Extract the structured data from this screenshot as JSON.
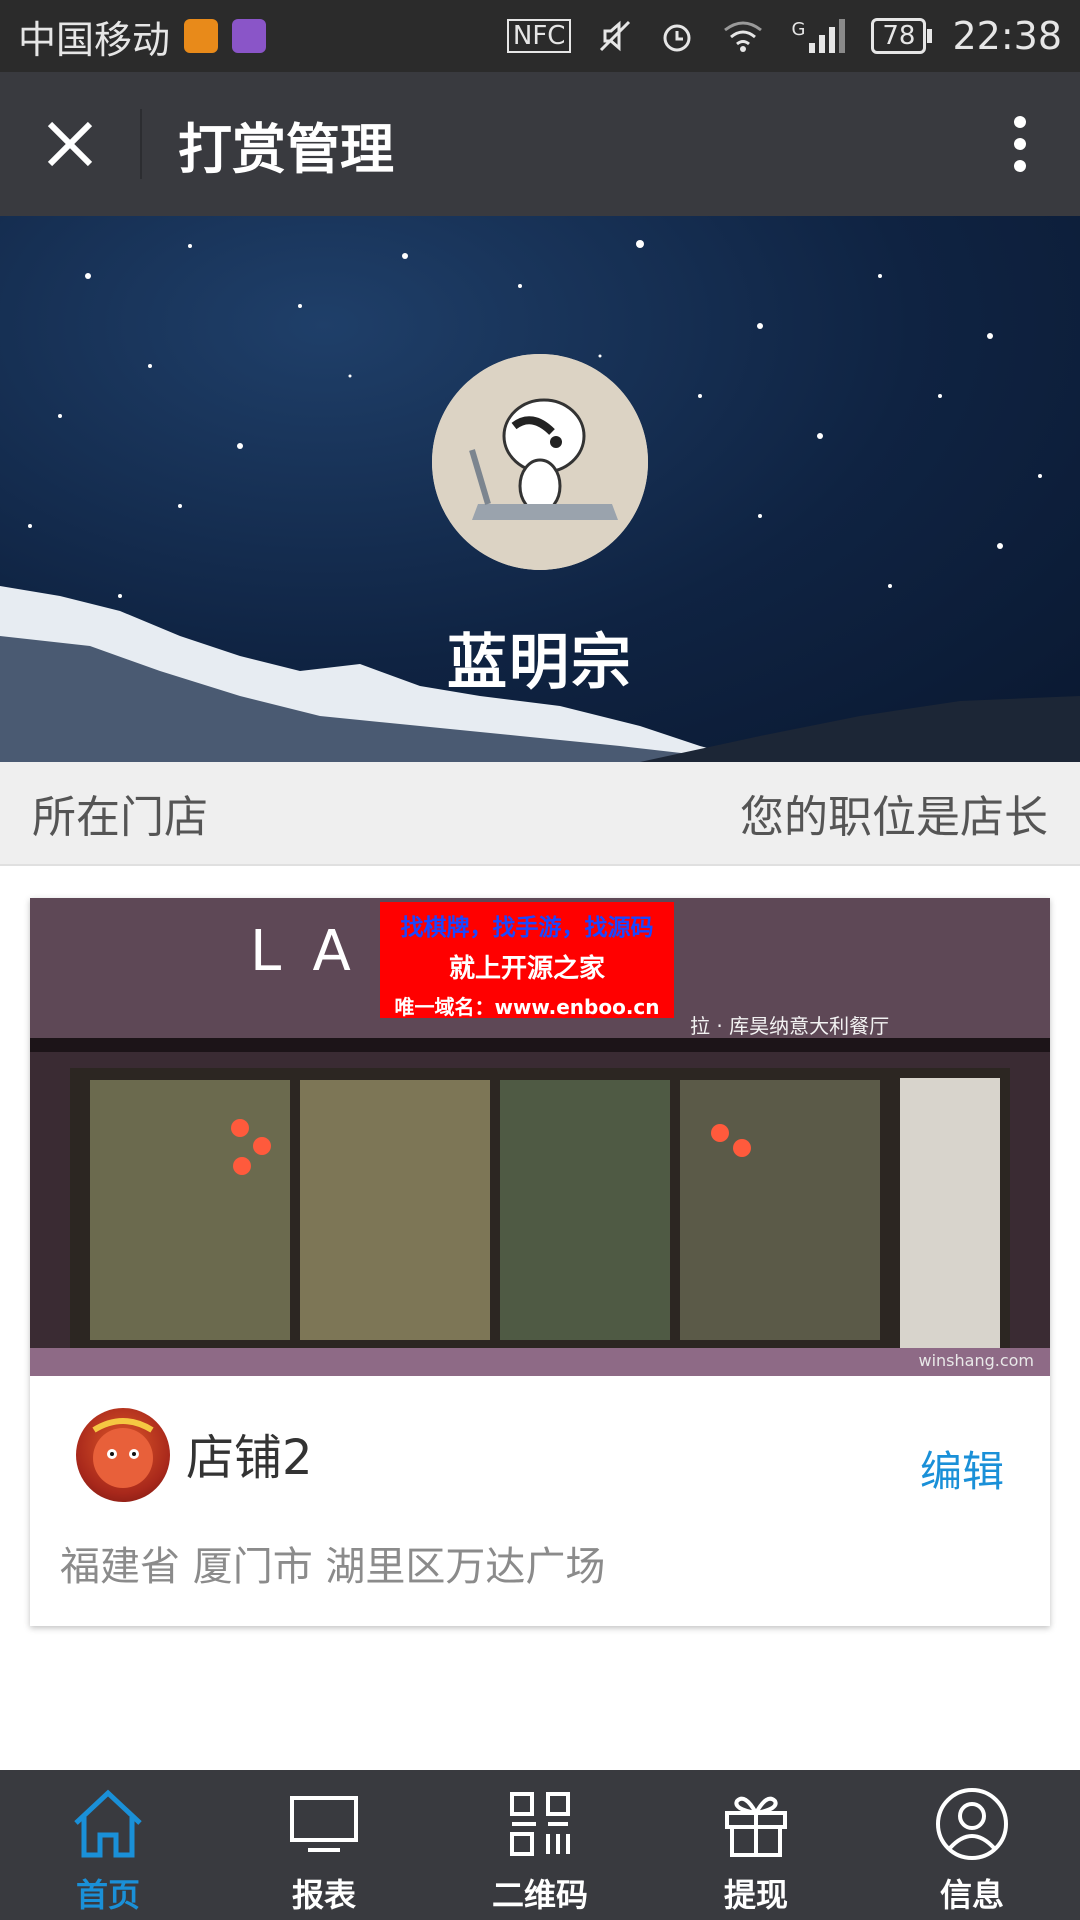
{
  "status_bar": {
    "carrier": "中国移动",
    "nfc": "NFC",
    "network": "G",
    "battery": "78",
    "time": "22:38"
  },
  "title_bar": {
    "title": "打赏管理",
    "close_icon": "close-icon",
    "more_icon": "more-vertical-icon"
  },
  "hero": {
    "name": "蓝明宗"
  },
  "store_header": {
    "left": "所在门店",
    "right": "您的职位是店长"
  },
  "store_card": {
    "name": "店铺2",
    "edit_label": "编辑",
    "address": "福建省 厦门市 湖里区万达广场",
    "image_sign": "LA",
    "image_sign_sub": "拉 · 库昊纳意大利餐厅",
    "image_credit": "winshang.com",
    "watermark": {
      "line1": "找棋牌，找手游，找源码",
      "line2": "就上开源之家",
      "line3": "唯一域名：www.enboo.cn"
    }
  },
  "bottom_nav": {
    "items": [
      {
        "label": "首页",
        "icon": "home-icon",
        "active": true
      },
      {
        "label": "报表",
        "icon": "monitor-icon",
        "active": false
      },
      {
        "label": "二维码",
        "icon": "qrcode-icon",
        "active": false
      },
      {
        "label": "提现",
        "icon": "gift-icon",
        "active": false
      },
      {
        "label": "信息",
        "icon": "user-icon",
        "active": false
      }
    ]
  },
  "colors": {
    "accent": "#1a90d8",
    "title_bar": "#393a3f",
    "status_bar": "#2b2b2b"
  }
}
